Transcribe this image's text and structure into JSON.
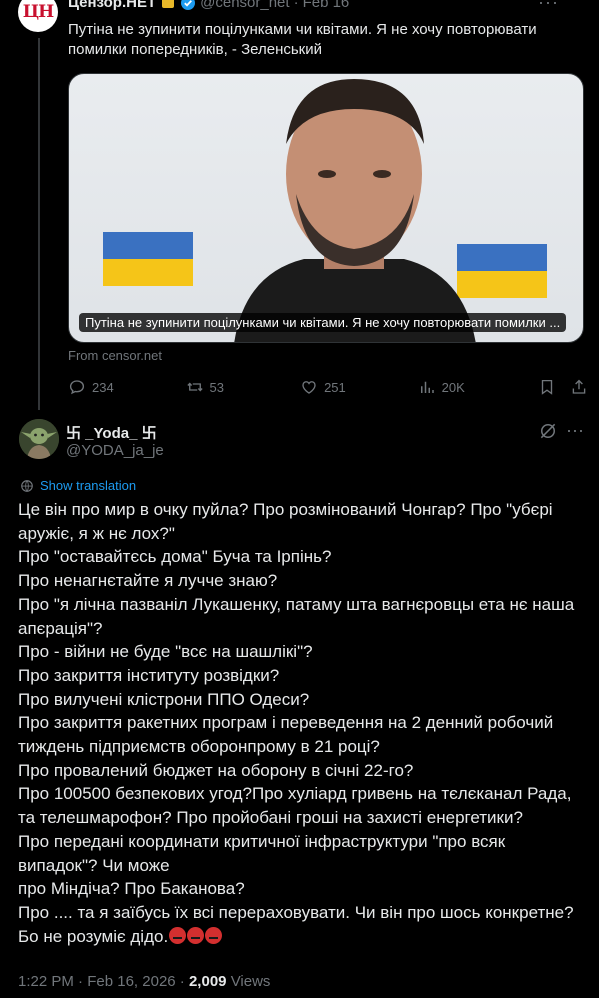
{
  "parent": {
    "name": "Цензор.НЕТ",
    "handle": "@censor_net",
    "time": "Feb 16",
    "separator": "·",
    "text": "Путіна не зупинити поцілунками чи квітами. Я не хочу повторювати помилки попередників, - Зеленський",
    "card_caption": "Путіна не зупинити поцілунками чи квітами. Я не хочу повторювати помилки ...",
    "card_source": "From censor.net",
    "stats": {
      "replies": "234",
      "reposts": "53",
      "likes": "251",
      "views": "20K"
    },
    "avatar_logo": "ЦН"
  },
  "main": {
    "name": "卐 _Yoda_ 卐",
    "handle": "@YODA_ja_je",
    "show_translation": "Show translation",
    "lines": [
      "Це він про мир в очку пуйла? Про розмінований Чонгар? Про \"убєрі аружіє, я ж нє лох?\"",
      "Про \"оставайтєсь дома\" Буча та Ірпінь?",
      "Про ненагнєтайте я лучче знаю?",
      "Про \"я лічна пазванiл Лукашенку, патаму шта вагнєровцы ета нє наша апєрація\"?",
      "Про - війни не буде \"всє на шашлікі\"?",
      "Про закриття інституту розвідки?",
      "Про вилучені клістрони ППО Одеси?",
      "Про закриття ракетних програм і переведення на 2 денний робочий тиждень підприємств оборонпрому в 21 році?",
      "Про провалений бюджет на оборону в січні 22-го?",
      "Про 100500 безпекових угод?Про хуліард гривень на тєлєканал Рада, та телешмарофон? Про пройобані гроші на захисті енергетики?",
      "Про передані координати критичної інфраструктури \"про всяк випадок\"? Чи може",
      "про Міндіча? Про Баканова?",
      "Про .... та я заїбусь їх всі перераховувати. Чи він про шось конкретне? Бо не розуміє дідо."
    ],
    "time": "1:22 PM",
    "date": "Feb 16, 2026",
    "separator": "·",
    "views_count": "2,009",
    "views_label": "Views"
  },
  "colors": {
    "background": "#000000",
    "text": "#e7e9ea",
    "muted": "#71767b",
    "accent": "#1d9bf0",
    "verified": "#1d9bf0",
    "gold": "#e8b829"
  }
}
